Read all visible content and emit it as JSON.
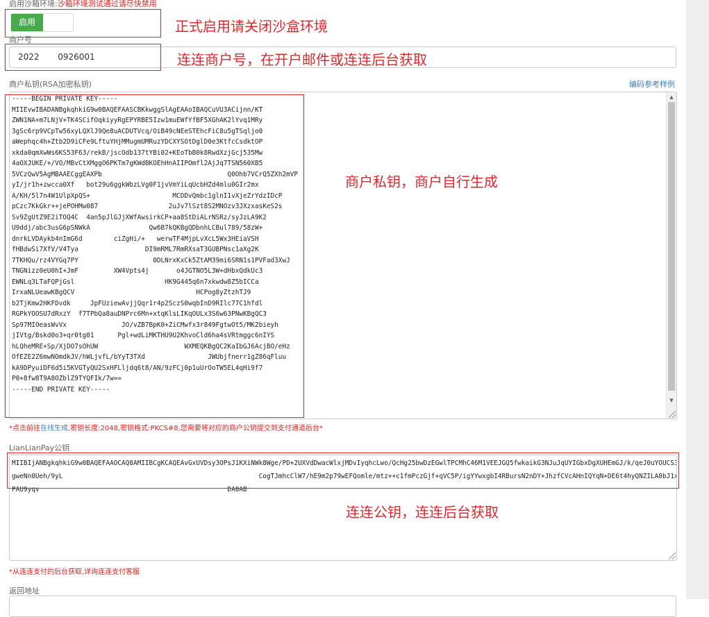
{
  "sandbox": {
    "label": "启用沙箱环境:",
    "warning": "沙箱环境测试通过请尽快禁用",
    "toggle_on_label": "启用"
  },
  "merchant_id": {
    "label": "商户号",
    "value": "2022       0926001"
  },
  "private_key": {
    "label": "商户私钥(RSA加密私钥)",
    "link_text": "编码参考样例",
    "lines": [
      "-----BEGIN PRIVATE KEY-----",
      "MIIEvwIBADANBgkqhkiG9w0BAQEFAASCBKkwggSlAgEAAoIBAQCuVU3ACijnn/KT",
      "ZWN1NA+m7LNjV+TK4SCifOqkiyyRgEPYRBE5Izw1muEWfYfBF5XGhAK2lYvq1MRy",
      "3gSc6rp9VCpTw56xyLQXlJ9Qe8uACDUTVcq/OiB49cNEeSTEhcFiC8u5gTSqljo0",
      "aWephqc4h+Ztb2D9iCFe9LftuYHjMMugmUMRuzYDCXYSOtDglD0e3KtfcCsdktOP",
      "xkda0qmXwWs6KS53F63/rekB/jscOdb137tYBi02+KEoTbB0k8RwdXzjGcj535Mw",
      "4aOXJUKE/+/VO/MBvCtXMggO6PKTm7gKWdBKOEhHnAIIPOmfl2AjJq7TSN560XB5",
      "5VCzQwV5AgMBAAECggEAXPb                                Q0Ohb7VCrQ5ZXh2mVP",
      "yI/jr1h+zwcca0Xf   bot29u6ggkWbzLVg0F1jvVmYiLqUcbHZd4mlu0GIr2mx",
      "A/KH/5l7n4W1UlpXpQS+                     MCDDvQmbc1glnI1vXjeZrYdzIDcP",
      "pCzc7KkGkr++jePOHMw087                  2uJv7lSzt8S2MNOzv3JXzxasKeS2s",
      "Sv9ZgUtZ9E2iTOQ4C  4an5pJlGJjXWfAwsirkCP+aa8StDiALrNSRz/syJzLA9K2",
      "U9ddj/abc3usG6pSNWkA               Qw6B7kQKBgQDbnhLCBul789/58zW+",
      "dnrkLVDAykb4nImG6d        ciZgHi/+   werwTF4MjpLvXcL5Wx3HEiaVSH",
      "fHBdwSi7XfV/V4Tya                 DI9mRML7RmRXsaT3GUBPNsc1aXg2K",
      "7TKHQu/rz4VYGq7PY                   0DLNrxKxCk5ZtAM39mi6SRN1s1PVFad3XwJ",
      "TNGNizz0eU0hI+JmF         XW4Vpts4j       o4JGTNO5L3W+dHbxQdkUc3",
      "EWNLq3LTaFQPjGsl                       HK9G445q6n7xkwdw8Z5bICCa",
      "IrxaNLUeawKBgQCV                               HCPog8yZtzhTJ9",
      "b2TjKmw2HKFDvdk     JpFUziewAvjjQqr1r4p2SczS0wqbInD9RIlc77C1hfdl",
      "RGPkYOOSU7dRxzY  f7TPbQa8auDNPrc6Mn+xtqKlsLIKqOULx3S6w63PNwKBgQC3",
      "Sp97MIOeasWvVx              JO/vZB7BpK0+ZiCMwfx3r849FgtwOt5/MK2bieyh",
      "jIVtg/Bskd0o3+qr0tg01      Pgl+wdLiMKTHU9U2KhvoCld6ha4sVRtmggc6nIYS",
      "hLQheMRE+Sp/XjDO7sOhUW                      WXMEQKBgQC2KaIbGJ6AcjBO/eHz",
      "OfEZE2Z6mwNOmdkJV/hWLjvfL/bYyT3TXd                JWUbjfnerr1gZ86qFluu",
      "kA9DPyuiDF6d5i5KVGTyQU2SxHFLljdq6t8/AN/9zFCj0p1uUrOoTW5EL4qHi9f7",
      "P0+8fw8T9A8OZblZ9TYQFIk/7w==",
      "-----END PRIVATE KEY-----"
    ]
  },
  "private_key_hint": {
    "prefix": "*点击前往",
    "link": "在线生成",
    "suffix": ",密钥长度:2048,密钥格式:PKCS#8,您需要将对应的商户公钥提交到支付通道后台*"
  },
  "public_key": {
    "label": "LianLianPay公钥",
    "value": "MIIBIjANBgkqhkiG9w0BAQEFAAOCAQ8AMIIBCgKCAQEAvGxUVDsy3OPsJ1KXiNWk8Wge/PD+2UXVdDwacWlxjMDvIyqhcLwo/QcHg25bwDzEGwlTPCMhC46M1VEEJGQ5fwkaikG3NJuJqUYIGbxDgXUHEmGJ/k/qeJ0uYOUCS3gweNn0Ueh/9yL                                                  CogTJmhcClW7/hE9m2p79wEFQomle/mtz++c1fmPczGjf+qVC5P/igYYwxgbI4RBursN2nDY+JhzfCVcAHnIQYqN+DE6t4hyQNZILA0bJ1xPAU9yqv                                                DA0AB"
  },
  "public_key_hint": "*从连连支付的后台获取,详询连连支付客服",
  "return_url": {
    "label": "返回地址"
  },
  "annotations": {
    "sandbox": "正式启用请关闭沙盒环境",
    "merchant_id": "连连商户号，在开户邮件或连连后台获取",
    "private_key": "商户私钥，商户自行生成",
    "public_key": "连连公钥，连连后台获取",
    "color": "#e0262d"
  }
}
